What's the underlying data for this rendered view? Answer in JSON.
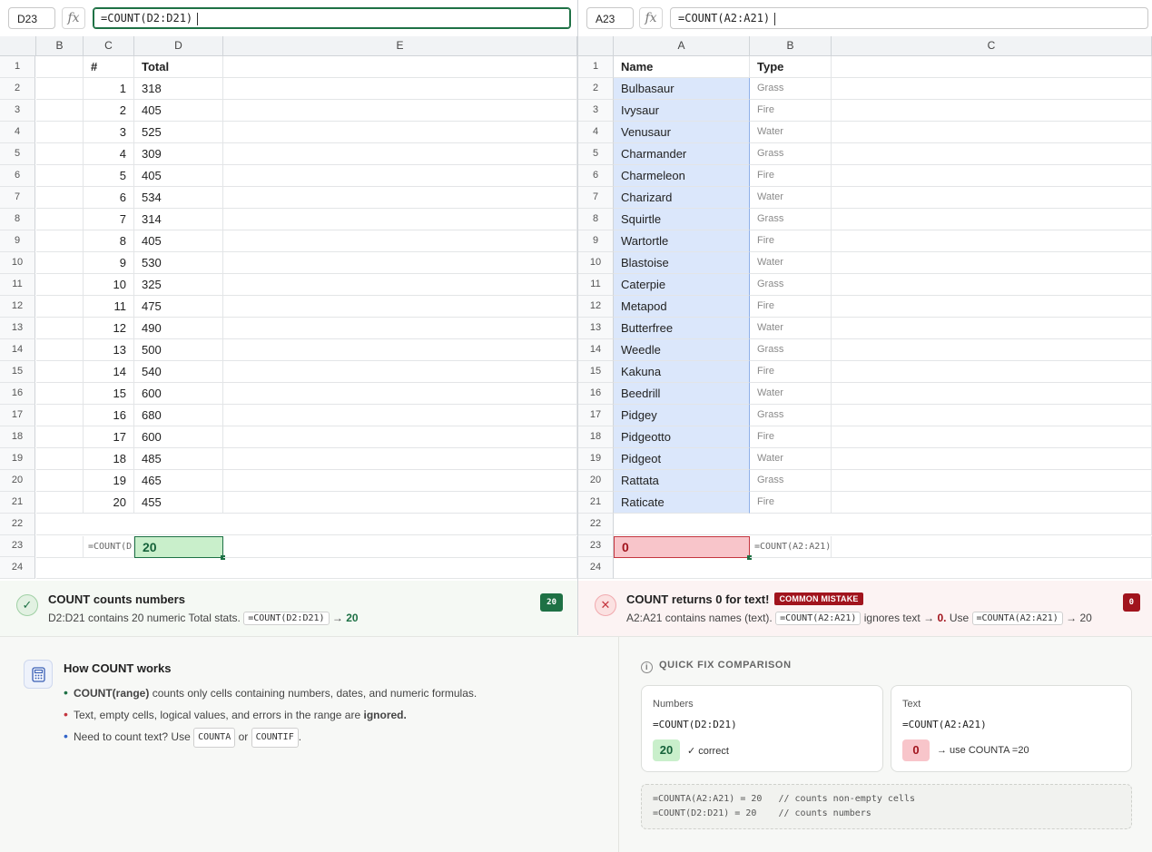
{
  "left_sheet": {
    "namebox": "D23",
    "fx_symbol": "fx",
    "formula": "=COUNT(D2:D21)",
    "columns": [
      "B",
      "C",
      "D",
      "E"
    ],
    "row_numbers": [
      "1",
      "2",
      "3",
      "4",
      "5",
      "6",
      "7",
      "8",
      "9",
      "10",
      "11",
      "12",
      "13",
      "14",
      "15",
      "16",
      "17",
      "18",
      "19",
      "20",
      "21",
      "22",
      "23",
      "24"
    ],
    "header_num": "#",
    "header_total": "Total",
    "rows": [
      {
        "num": "1",
        "total": "318"
      },
      {
        "num": "2",
        "total": "405"
      },
      {
        "num": "3",
        "total": "525"
      },
      {
        "num": "4",
        "total": "309"
      },
      {
        "num": "5",
        "total": "405"
      },
      {
        "num": "6",
        "total": "534"
      },
      {
        "num": "7",
        "total": "314"
      },
      {
        "num": "8",
        "total": "405"
      },
      {
        "num": "9",
        "total": "530"
      },
      {
        "num": "10",
        "total": "325"
      },
      {
        "num": "11",
        "total": "475"
      },
      {
        "num": "12",
        "total": "490"
      },
      {
        "num": "13",
        "total": "500"
      },
      {
        "num": "14",
        "total": "540"
      },
      {
        "num": "15",
        "total": "600"
      },
      {
        "num": "16",
        "total": "680"
      },
      {
        "num": "17",
        "total": "600"
      },
      {
        "num": "18",
        "total": "485"
      },
      {
        "num": "19",
        "total": "465"
      },
      {
        "num": "20",
        "total": "455"
      }
    ],
    "formula_label": "=COUNT(D",
    "result": "20"
  },
  "right_sheet": {
    "namebox": "A23",
    "fx_symbol": "fx",
    "formula": "=COUNT(A2:A21)",
    "columns": [
      "A",
      "B",
      "C"
    ],
    "row_numbers": [
      "1",
      "2",
      "3",
      "4",
      "5",
      "6",
      "7",
      "8",
      "9",
      "10",
      "11",
      "12",
      "13",
      "14",
      "15",
      "16",
      "17",
      "18",
      "19",
      "20",
      "21",
      "22",
      "23",
      "24"
    ],
    "header_name": "Name",
    "header_type": "Type",
    "rows": [
      {
        "name": "Bulbasaur",
        "type": "Grass"
      },
      {
        "name": "Ivysaur",
        "type": "Fire"
      },
      {
        "name": "Venusaur",
        "type": "Water"
      },
      {
        "name": "Charmander",
        "type": "Grass"
      },
      {
        "name": "Charmeleon",
        "type": "Fire"
      },
      {
        "name": "Charizard",
        "type": "Water"
      },
      {
        "name": "Squirtle",
        "type": "Grass"
      },
      {
        "name": "Wartortle",
        "type": "Fire"
      },
      {
        "name": "Blastoise",
        "type": "Water"
      },
      {
        "name": "Caterpie",
        "type": "Grass"
      },
      {
        "name": "Metapod",
        "type": "Fire"
      },
      {
        "name": "Butterfree",
        "type": "Water"
      },
      {
        "name": "Weedle",
        "type": "Grass"
      },
      {
        "name": "Kakuna",
        "type": "Fire"
      },
      {
        "name": "Beedrill",
        "type": "Water"
      },
      {
        "name": "Pidgey",
        "type": "Grass"
      },
      {
        "name": "Pidgeotto",
        "type": "Fire"
      },
      {
        "name": "Pidgeot",
        "type": "Water"
      },
      {
        "name": "Rattata",
        "type": "Grass"
      },
      {
        "name": "Raticate",
        "type": "Fire"
      }
    ],
    "result": "0",
    "formula_label": "=COUNT(A2:A21)"
  },
  "banner_ok": {
    "icon": "✓",
    "title": "COUNT counts numbers",
    "text_before": "D2:D21 contains 20 numeric Total stats.",
    "code": "=COUNT(D2:D21)",
    "arrow": "→",
    "result": "20",
    "pill": "20"
  },
  "banner_bad": {
    "icon": "✕",
    "title": "COUNT returns 0 for text!",
    "tag": "COMMON MISTAKE",
    "text_before": "A2:A21 contains names (text).",
    "code": "=COUNT(A2:A21)",
    "text_mid": "ignores text →",
    "zero": "0.",
    "text_use": "Use",
    "code2": "=COUNTA(A2:A21)",
    "text_end": "→ 20",
    "pill": "0"
  },
  "how": {
    "title": "How COUNT works",
    "item1_strong": "COUNT(range)",
    "item1_rest": "counts only cells containing numbers, dates, and numeric formulas.",
    "item2_before": "Text, empty cells, logical values, and errors in the range are",
    "item2_strong": "ignored.",
    "item3_before": "Need to count text? Use",
    "item3_code1": "COUNTA",
    "item3_or": "or",
    "item3_code2": "COUNTIF",
    "item3_end": "."
  },
  "quick_fix": {
    "info_icon": "i",
    "title": "QUICK FIX COMPARISON",
    "card_numbers": {
      "label": "Numbers",
      "formula": "=COUNT(D2:D21)",
      "value": "20",
      "note": "✓ correct"
    },
    "card_text": {
      "label": "Text",
      "formula": "=COUNT(A2:A21)",
      "value": "0",
      "note": "→ use COUNTA =20"
    },
    "code_line1": "=COUNTA(A2:A21) = 20   // counts non-empty cells",
    "code_line2": "=COUNT(D2:D21) = 20    // counts numbers"
  },
  "colors": {
    "success": "#1e7145",
    "danger": "#a1141d",
    "selection": "#dbe7fb"
  }
}
